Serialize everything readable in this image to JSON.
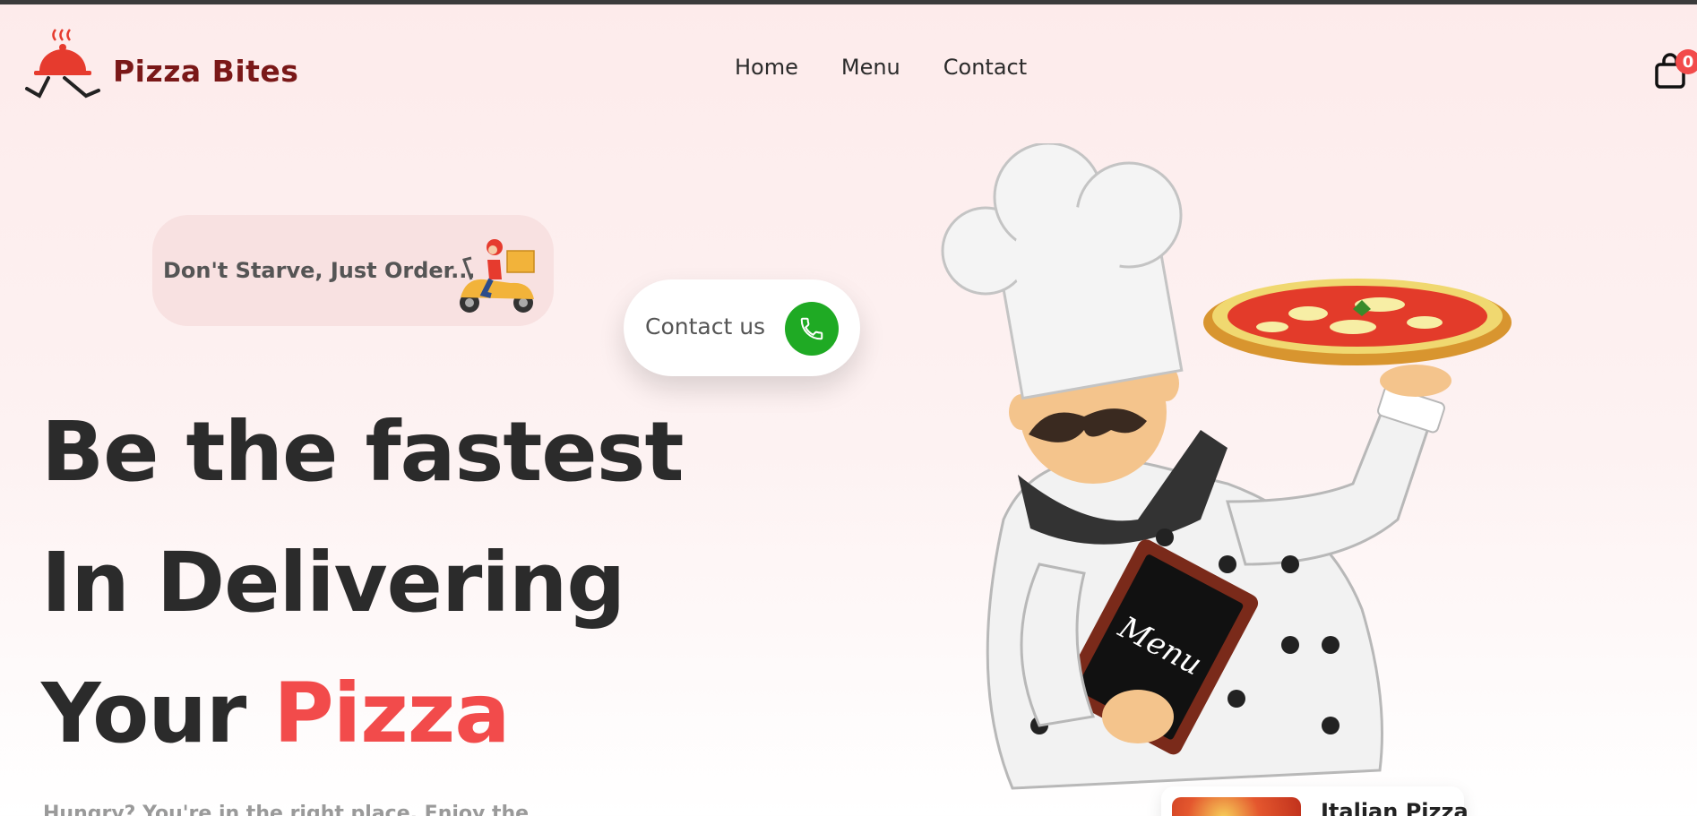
{
  "brand": {
    "name": "Pizza Bites"
  },
  "nav": {
    "items": [
      "Home",
      "Menu",
      "Contact"
    ]
  },
  "cart": {
    "count": "0"
  },
  "hero": {
    "tagline": "Don't Starve, Just Order...",
    "contact_label": "Contact us",
    "headline_line1": "Be the fastest",
    "headline_line2": "In Delivering",
    "headline_line3_prefix": "Your ",
    "headline_line3_accent": "Pizza",
    "subtext": "Hungry? You're in the right place. Enjoy the",
    "illustration_menu_text": "Menu"
  },
  "featured_card": {
    "title": "Italian Pizza"
  },
  "colors": {
    "accent": "#f24b4b",
    "brand_text": "#7a1818",
    "phone_button": "#1faa24",
    "background": "#fdebeb"
  },
  "icons": [
    "logo-cloche-icon",
    "cart-bag-icon",
    "scooter-rider-icon",
    "phone-icon"
  ]
}
